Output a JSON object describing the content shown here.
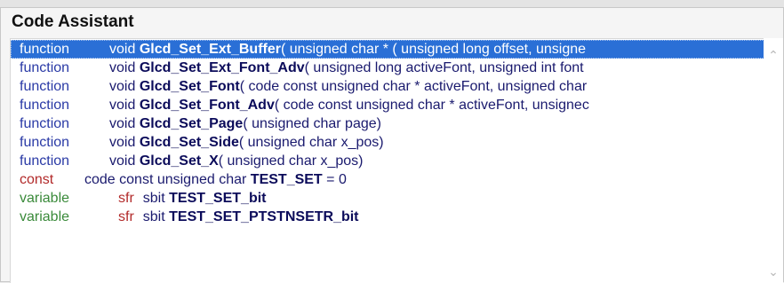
{
  "panel": {
    "title": "Code Assistant"
  },
  "items": [
    {
      "kind": "function",
      "return_type": "void",
      "name": "Glcd_Set_Ext_Buffer",
      "params": "( unsigned char * ( unsigned long offset,  unsigne",
      "selected": true
    },
    {
      "kind": "function",
      "return_type": "void",
      "name": "Glcd_Set_Ext_Font_Adv",
      "params": "( unsigned long activeFont,  unsigned int font",
      "selected": false
    },
    {
      "kind": "function",
      "return_type": "void",
      "name": "Glcd_Set_Font",
      "params": "( code const unsigned char * activeFont,  unsigned char",
      "selected": false
    },
    {
      "kind": "function",
      "return_type": "void",
      "name": "Glcd_Set_Font_Adv",
      "params": "( code const unsigned char * activeFont,  unsignec",
      "selected": false
    },
    {
      "kind": "function",
      "return_type": "void",
      "name": "Glcd_Set_Page",
      "params": "( unsigned char page)",
      "selected": false
    },
    {
      "kind": "function",
      "return_type": "void",
      "name": "Glcd_Set_Side",
      "params": "( unsigned char x_pos)",
      "selected": false
    },
    {
      "kind": "function",
      "return_type": "void",
      "name": "Glcd_Set_X",
      "params": "( unsigned char x_pos)",
      "selected": false
    },
    {
      "kind": "const",
      "return_type": "code const unsigned char",
      "name": "TEST_SET",
      "params": " = 0",
      "selected": false
    },
    {
      "kind": "variable",
      "qualifier": "sfr",
      "return_type": "sbit",
      "name": "TEST_SET_bit",
      "params": "",
      "selected": false
    },
    {
      "kind": "variable",
      "qualifier": "sfr",
      "return_type": "sbit",
      "name": "TEST_SET_PTSTNSETR_bit",
      "params": "",
      "selected": false
    }
  ],
  "scrollbar": {
    "up_icon": "chevron-up-icon",
    "down_icon": "chevron-down-icon"
  },
  "colors": {
    "selection": "#2a6fd6",
    "function_kind": "#2a3aa6",
    "const_kind": "#b22a2a",
    "variable_kind": "#3a8a3a"
  }
}
